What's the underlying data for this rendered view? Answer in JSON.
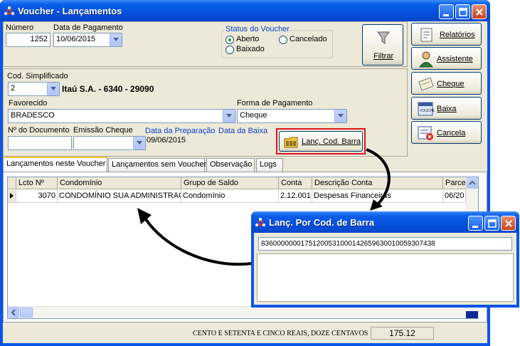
{
  "window": {
    "title": "Voucher - Lançamentos"
  },
  "header": {
    "numero_label": "Número",
    "numero_value": "1252",
    "data_pagamento_label": "Data de Pagamento",
    "data_pagamento_value": "10/06/2015",
    "status_label": "Status do Voucher",
    "status_options": [
      "Aberto",
      "Cancelado",
      "Baixado"
    ],
    "status_selected": "Aberto",
    "filtrar_label": "Filtrar"
  },
  "side_buttons": [
    "Relatórios",
    "Assistente",
    "Cheque",
    "Baixa",
    "Cancela"
  ],
  "form": {
    "cod_simplificado_label": "Cod. Simplificado",
    "cod_simplificado_value": "2",
    "bank_info": "Itaú S.A. - 6340 - 29090",
    "favorecido_label": "Favorecido",
    "favorecido_value": "BRADESCO",
    "forma_pagamento_label": "Forma de Pagamento",
    "forma_pagamento_value": "Cheque",
    "documento_label": "Nº do Documento",
    "emissao_label": "Emissão Cheque",
    "data_preparacao_label": "Data da Preparação",
    "data_preparacao_value": "09/06/2015",
    "data_baixa_label": "Data da Baixa",
    "lanc_cod_barra_label": "Lanç. Cod. Barra"
  },
  "tabs": [
    "Lançamentos neste Voucher",
    "Lançamentos sem Voucher",
    "Observação",
    "Logs"
  ],
  "grid": {
    "columns": [
      "Lcto Nº",
      "Condomínio",
      "Grupo de Saldo",
      "Conta",
      "Descrição Conta",
      "Parce"
    ],
    "rows": [
      [
        "3070",
        "CONDOMÍNIO SUA ADMINISTRAÇ",
        "Condomínio",
        "2.12.001",
        "Despesas Financeiras",
        "06/20"
      ]
    ]
  },
  "footer": {
    "valor_extenso": "CENTO E SETENTA E CINCO REAIS, DOZE CENTAVOS",
    "valor_total": "175.12"
  },
  "popup": {
    "title": "Lanç. Por Cod. de Barra",
    "barcode_value": "83600000001751200531000142659630010059307438"
  },
  "colors": {
    "titlebar": "#0550de",
    "dialog_bg": "#ece9d8",
    "highlight_border": "#e0141e",
    "label_blue": "#0a3ec8"
  }
}
